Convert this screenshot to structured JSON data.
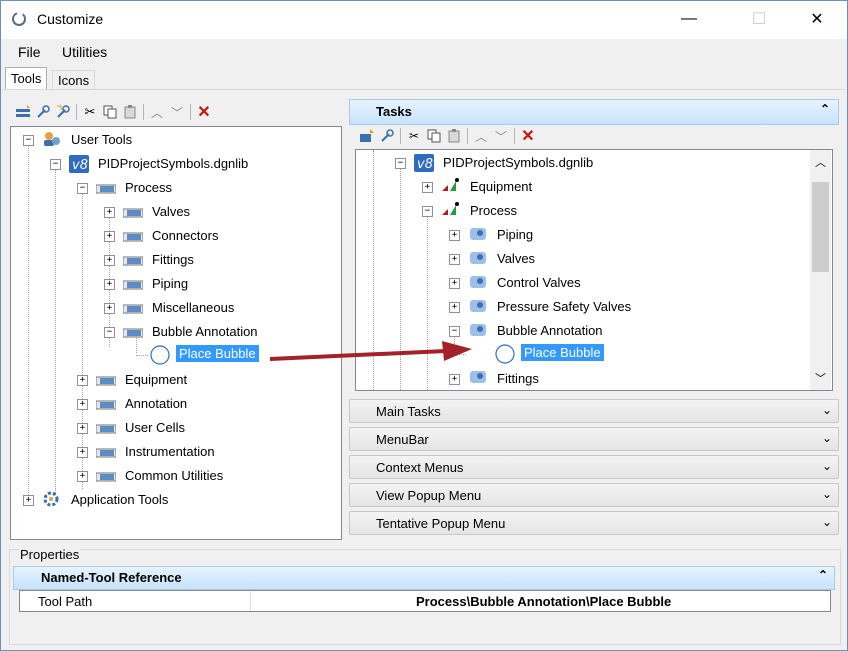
{
  "window": {
    "title": "Customize",
    "minimize": "—",
    "maximize": "☐",
    "close": "✕"
  },
  "menu": {
    "file": "File",
    "utilities": "Utilities"
  },
  "tabs": {
    "tools": "Tools",
    "icons": "Icons"
  },
  "left_tree": {
    "root": "User Tools",
    "library": "PIDProjectSymbols.dgnlib",
    "process": "Process",
    "process_children": [
      "Valves",
      "Connectors",
      "Fittings",
      "Piping",
      "Miscellaneous",
      "Bubble Annotation"
    ],
    "place_bubble": "Place Bubble",
    "siblings": [
      "Equipment",
      "Annotation",
      "User Cells",
      "Instrumentation",
      "Common Utilities"
    ],
    "app_tools": "Application Tools"
  },
  "tasks": {
    "header": "Tasks",
    "library": "PIDProjectSymbols.dgnlib",
    "equipment": "Equipment",
    "process": "Process",
    "children": [
      "Piping",
      "Valves",
      "Control Valves",
      "Pressure Safety Valves",
      "Bubble Annotation"
    ],
    "place_bubble": "Place Bubble",
    "fittings": "Fittings"
  },
  "sections": [
    "Main Tasks",
    "MenuBar",
    "Context Menus",
    "View Popup Menu",
    "Tentative Popup Menu"
  ],
  "properties": {
    "title": "Properties",
    "section": "Named-Tool Reference",
    "row_label": "Tool Path",
    "row_value": "Process\\Bubble Annotation\\Place Bubble"
  },
  "colors": {
    "selection": "#3399ff",
    "arrow": "#a3222a",
    "delete": "#d01010"
  }
}
